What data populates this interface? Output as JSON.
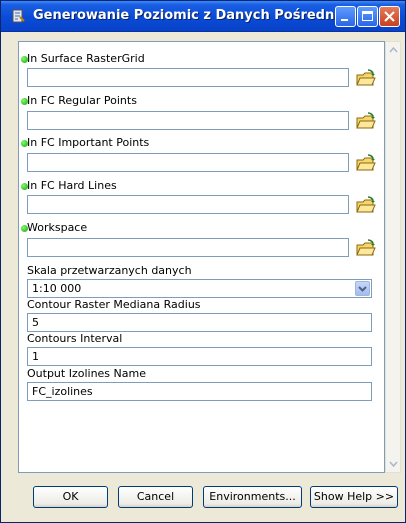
{
  "window": {
    "title": "Generowanie Poziomic z Danych Pośrednich"
  },
  "params": [
    {
      "label": "In Surface RasterGrid",
      "value": ""
    },
    {
      "label": "In FC Regular Points",
      "value": ""
    },
    {
      "label": "In FC Important Points",
      "value": ""
    },
    {
      "label": "In FC Hard Lines",
      "value": ""
    },
    {
      "label": "Workspace",
      "value": ""
    }
  ],
  "scale": {
    "label": "Skala przetwarzanych danych",
    "value": "1:10 000"
  },
  "radius": {
    "label": "Contour Raster Mediana Radius",
    "value": "5"
  },
  "interval": {
    "label": "Contours Interval",
    "value": "1"
  },
  "output": {
    "label": "Output Izolines Name",
    "value": "FC_izolines"
  },
  "buttons": {
    "ok": "OK",
    "cancel": "Cancel",
    "environments": "Environments...",
    "help": "Show Help >>"
  },
  "colors": {
    "titlebar": "#0A4BD6",
    "dialog": "#ECE9D8",
    "required_dot": "#1E9E16"
  }
}
